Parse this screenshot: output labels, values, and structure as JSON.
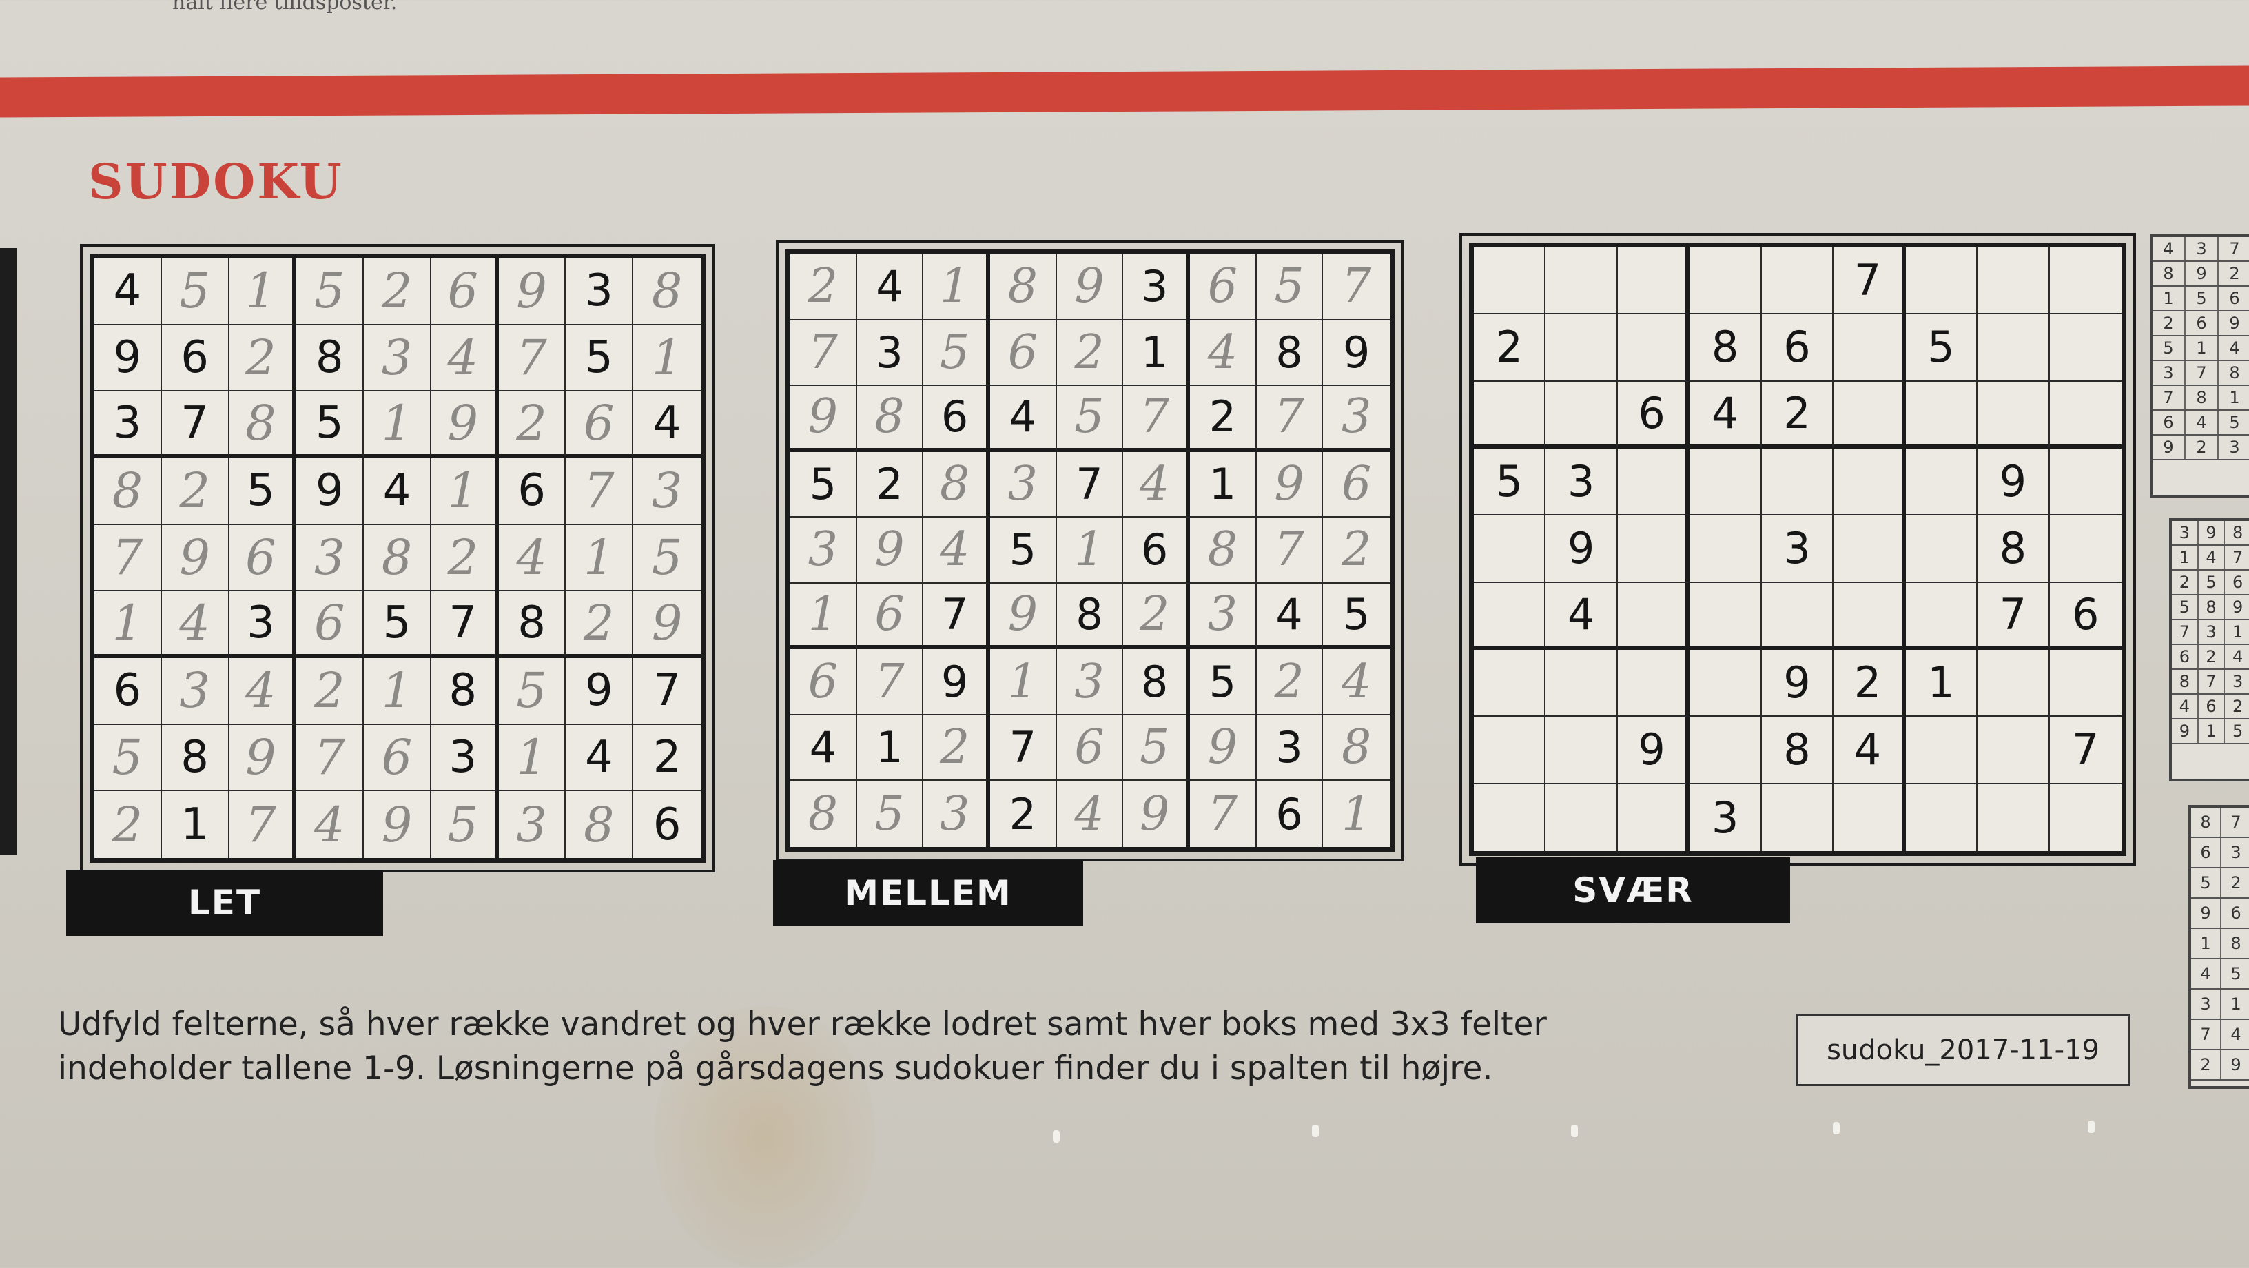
{
  "header": {
    "clipped_text": "halt flere tilidsposter.",
    "title": "SUDOKU"
  },
  "puzzles": [
    {
      "label": "LET",
      "printed": [
        [
          "4",
          "",
          "",
          "",
          "",
          "",
          "",
          "3",
          ""
        ],
        [
          "9",
          "6",
          "",
          "8",
          "",
          "",
          "",
          "5",
          ""
        ],
        [
          "3",
          "7",
          "",
          "5",
          "",
          "",
          "",
          "",
          "4"
        ],
        [
          "",
          "",
          "5",
          "9",
          "4",
          "",
          "6",
          "",
          ""
        ],
        [
          "",
          "",
          "",
          "",
          "",
          "",
          "",
          "",
          ""
        ],
        [
          "",
          "",
          "3",
          "",
          "5",
          "7",
          "8",
          "",
          ""
        ],
        [
          "6",
          "",
          "",
          "",
          "",
          "8",
          "",
          "9",
          "7"
        ],
        [
          "",
          "8",
          "",
          "",
          "",
          "3",
          "",
          "4",
          "2"
        ],
        [
          "",
          "1",
          "",
          "",
          "",
          "",
          "",
          "",
          "6"
        ]
      ],
      "handwritten": [
        [
          "",
          "5",
          "1",
          "5",
          "2",
          "6",
          "9",
          "",
          "8"
        ],
        [
          "",
          "",
          "2",
          "",
          "3",
          "4",
          "7",
          "",
          "1"
        ],
        [
          "",
          "",
          "8",
          "",
          "1",
          "9",
          "2",
          "6",
          ""
        ],
        [
          "8",
          "2",
          "",
          "",
          "",
          "1",
          "",
          "7",
          "3"
        ],
        [
          "7",
          "9",
          "6",
          "3",
          "8",
          "2",
          "4",
          "1",
          "5"
        ],
        [
          "1",
          "4",
          "",
          "6",
          "",
          "",
          "",
          "2",
          "9"
        ],
        [
          "",
          "3",
          "4",
          "2",
          "1",
          "",
          "5",
          "",
          ""
        ],
        [
          "5",
          "",
          "9",
          "7",
          "6",
          "",
          "1",
          "",
          ""
        ],
        [
          "2",
          "",
          "7",
          "4",
          "9",
          "5",
          "3",
          "8",
          ""
        ]
      ]
    },
    {
      "label": "MELLEM",
      "printed": [
        [
          "",
          "4",
          "",
          "",
          "",
          "3",
          "",
          "",
          ""
        ],
        [
          "",
          "3",
          "",
          "",
          "",
          "1",
          "",
          "8",
          "9"
        ],
        [
          "",
          "",
          "6",
          "4",
          "",
          "",
          "2",
          "",
          ""
        ],
        [
          "5",
          "2",
          "",
          "",
          "7",
          "",
          "1",
          "",
          ""
        ],
        [
          "",
          "",
          "",
          "5",
          "",
          "6",
          "",
          "",
          ""
        ],
        [
          "",
          "",
          "7",
          "",
          "8",
          "",
          "",
          "4",
          "5"
        ],
        [
          "",
          "",
          "9",
          "",
          "",
          "8",
          "5",
          "",
          ""
        ],
        [
          "4",
          "1",
          "",
          "7",
          "",
          "",
          "",
          "3",
          ""
        ],
        [
          "",
          "",
          "",
          "2",
          "",
          "",
          "",
          "6",
          ""
        ]
      ],
      "handwritten": [
        [
          "2",
          "",
          "1",
          "8",
          "9",
          "",
          "6",
          "5",
          "7"
        ],
        [
          "7",
          "",
          "5",
          "6",
          "2",
          "",
          "4",
          "",
          ""
        ],
        [
          "9",
          "8",
          "",
          "",
          "5",
          "7",
          "",
          "7",
          "3"
        ],
        [
          "",
          "",
          "8",
          "3",
          "",
          "4",
          "",
          "9",
          "6"
        ],
        [
          "3",
          "9",
          "4",
          "",
          "1",
          "",
          "8",
          "7",
          "2"
        ],
        [
          "1",
          "6",
          "",
          "9",
          "",
          "2",
          "3",
          "",
          ""
        ],
        [
          "6",
          "7",
          "",
          "1",
          "3",
          "",
          "",
          "2",
          "4"
        ],
        [
          "",
          "",
          "2",
          "",
          "6",
          "5",
          "9",
          "",
          "8"
        ],
        [
          "8",
          "5",
          "3",
          "",
          "4",
          "9",
          "7",
          "",
          "1"
        ]
      ]
    },
    {
      "label": "SVÆR",
      "printed": [
        [
          "",
          "",
          "",
          "",
          "",
          "7",
          "",
          "",
          ""
        ],
        [
          "2",
          "",
          "",
          "8",
          "6",
          "",
          "5",
          "",
          ""
        ],
        [
          "",
          "",
          "6",
          "4",
          "2",
          "",
          "",
          "",
          ""
        ],
        [
          "5",
          "3",
          "",
          "",
          "",
          "",
          "",
          "9",
          ""
        ],
        [
          "",
          "9",
          "",
          "",
          "3",
          "",
          "",
          "8",
          ""
        ],
        [
          "",
          "4",
          "",
          "",
          "",
          "",
          "",
          "7",
          "6"
        ],
        [
          "",
          "",
          "",
          "",
          "9",
          "2",
          "1",
          "",
          ""
        ],
        [
          "",
          "",
          "9",
          "",
          "8",
          "4",
          "",
          "",
          "7"
        ],
        [
          "",
          "",
          "",
          "3",
          "",
          "",
          "",
          "",
          ""
        ]
      ],
      "handwritten": [
        [
          "",
          "",
          "",
          "",
          "",
          "",
          "",
          "",
          ""
        ],
        [
          "",
          "",
          "",
          "",
          "",
          "",
          "",
          "",
          ""
        ],
        [
          "",
          "",
          "",
          "",
          "",
          "",
          "",
          "",
          ""
        ],
        [
          "",
          "",
          "",
          "",
          "",
          "",
          "",
          "",
          ""
        ],
        [
          "",
          "",
          "",
          "",
          "",
          "",
          "",
          "",
          ""
        ],
        [
          "",
          "",
          "",
          "",
          "",
          "",
          "",
          "",
          ""
        ],
        [
          "",
          "",
          "",
          "",
          "",
          "",
          "",
          "",
          ""
        ],
        [
          "",
          "",
          "",
          "",
          "",
          "",
          "",
          "",
          ""
        ],
        [
          "",
          "",
          "",
          "",
          "",
          "",
          "",
          "",
          ""
        ]
      ]
    }
  ],
  "instructions": {
    "line1": "Udfyld felterne, så hver række vandret og hver række lodret samt hver boks med 3x3 felter",
    "line2": "indeholder tallene 1-9. Løsningerne på gårsdagens sudokuer finder du i spalten til højre."
  },
  "puzzle_id": "sudoku_2017-11-19",
  "solutions_column": {
    "block1": [
      "437",
      "892",
      "156",
      "269",
      "514",
      "378",
      "781",
      "645",
      "923"
    ],
    "block2": [
      "398",
      "147",
      "256",
      "589",
      "731",
      "624",
      "873",
      "462",
      "915"
    ],
    "block3": [
      "87",
      "63",
      "52",
      "96",
      "18",
      "45",
      "31",
      "74",
      "29"
    ]
  },
  "colors": {
    "accent_red": "#d0453a",
    "title_red": "#c9433a",
    "label_bg": "#141414"
  }
}
